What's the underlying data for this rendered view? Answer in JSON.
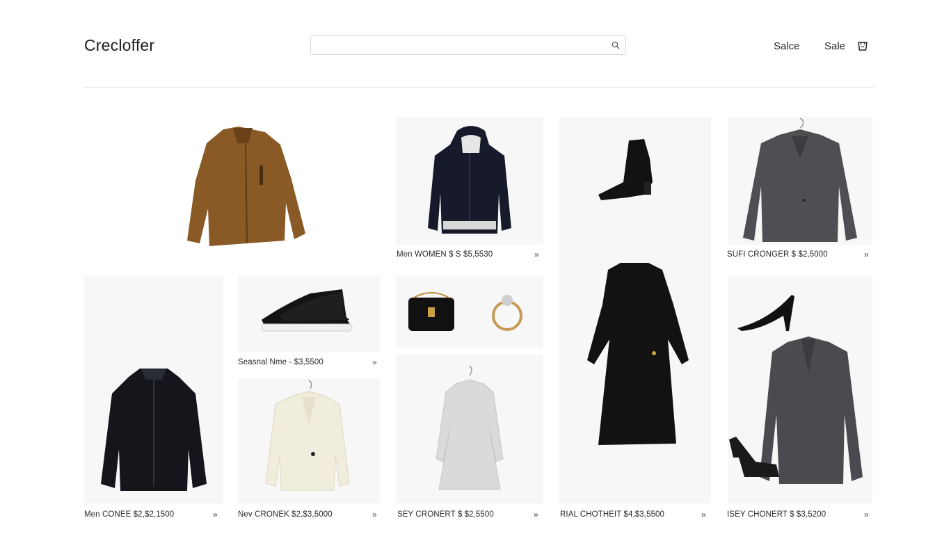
{
  "header": {
    "logo": "Crecloffer",
    "search": {
      "value": "",
      "placeholder": ""
    },
    "nav": [
      "Salce",
      "Sale"
    ]
  },
  "products": [
    {
      "caption": "Men WOMEN $ S $5,5530",
      "icon": "hooded-jacket-image"
    },
    {
      "caption": "SUFI CRONGER $ $2,5000",
      "icon": "grey-blazer-image"
    },
    {
      "caption": "Seasnal Nme - $3,5500",
      "icon": "sneakers-image"
    },
    {
      "caption": "Men CONEE $2,$2,1500",
      "icon": "black-bomber-image"
    },
    {
      "caption": "Nev CRONEK $2,$3,5000",
      "icon": "cream-blazer-image"
    },
    {
      "caption": "SEY CRONERT $ $2,5500",
      "icon": "lace-dress-image"
    },
    {
      "caption": "RIAL CHOTHEIT $4,$3,5500",
      "icon": "black-dress-image"
    },
    {
      "caption": "ISEY CHONERT $ $3,5200",
      "icon": "grey-coat-image"
    }
  ],
  "more_symbol": "»",
  "colors": {
    "text": "#1a1a1a",
    "divider": "#e3e3e3",
    "tile_bg": "#f7f7f7"
  }
}
